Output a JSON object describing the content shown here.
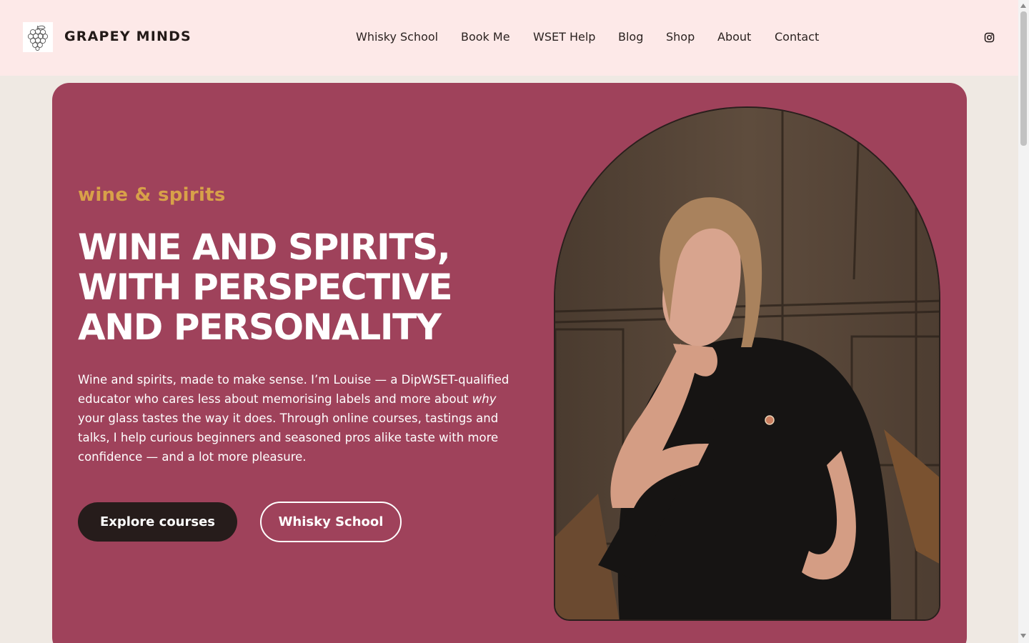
{
  "header": {
    "brand": "GRAPEY MINDS",
    "logo_icon": "grape-bunch-icon",
    "nav": [
      {
        "label": "Whisky School"
      },
      {
        "label": "Book Me"
      },
      {
        "label": "WSET Help"
      },
      {
        "label": "Blog"
      },
      {
        "label": "Shop"
      },
      {
        "label": "About"
      },
      {
        "label": "Contact"
      }
    ],
    "social_icon": "instagram-icon"
  },
  "hero": {
    "eyebrow": "wine & spirits",
    "headline": "WINE AND SPIRITS,\nWITH PERSPECTIVE\nAND PERSONALITY",
    "body_before": "Wine and spirits, made to make sense. I’m Louise — a DipWSET-qualified educator who cares less about memorising labels and more about ",
    "body_em": "why",
    "body_after": " your glass tastes the way it does. Through online courses, tastings and talks, I help curious beginners and seasoned pros alike taste with more confidence — and a lot more pleasure.",
    "primary_button": "Explore courses",
    "secondary_button": "Whisky School",
    "portrait_icon": "portrait-photo"
  },
  "colors": {
    "header_bg": "#fde9e8",
    "page_bg": "#efe9e3",
    "hero_bg": "#9f425b",
    "accent": "#d8a149",
    "button_dark": "#261c1b"
  }
}
